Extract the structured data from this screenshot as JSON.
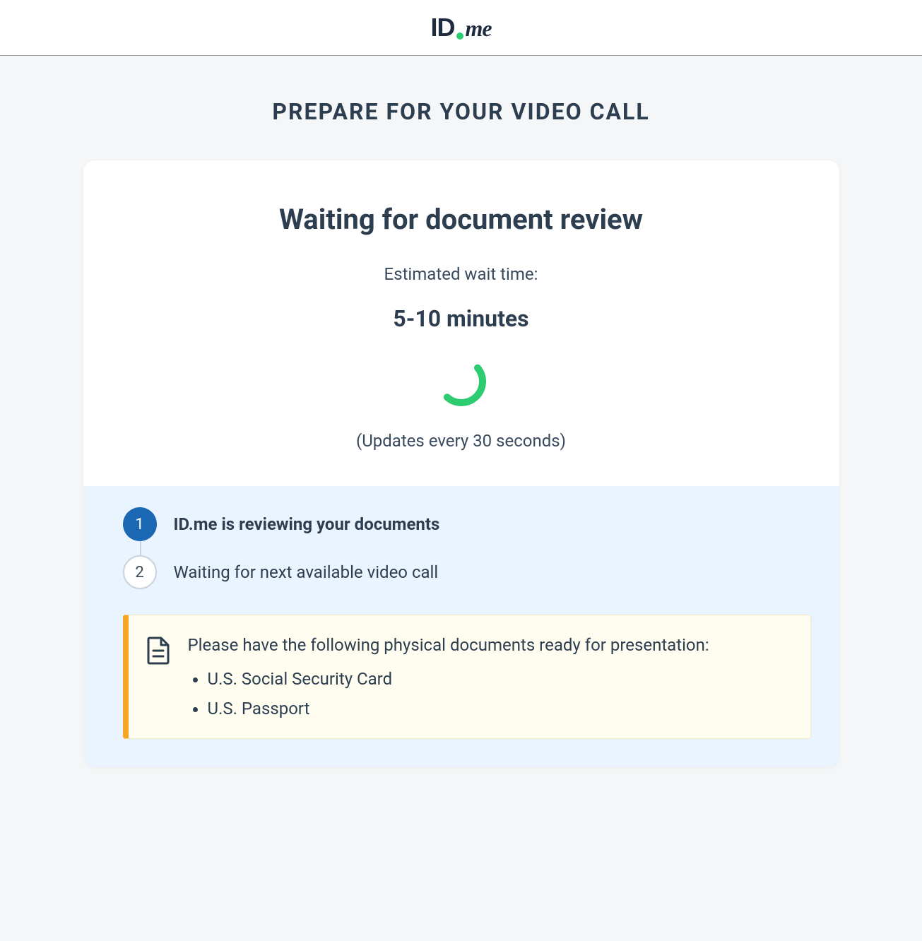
{
  "header": {
    "logo_id": "ID",
    "logo_me": "me"
  },
  "page_title": "PREPARE FOR YOUR VIDEO CALL",
  "card": {
    "heading": "Waiting for document review",
    "wait_label": "Estimated wait time:",
    "wait_time": "5-10 minutes",
    "update_note": "(Updates every 30 seconds)"
  },
  "steps": [
    {
      "number": "1",
      "label": "ID.me is reviewing your documents",
      "active": true
    },
    {
      "number": "2",
      "label": "Waiting for next available video call",
      "active": false
    }
  ],
  "notice": {
    "text": "Please have the following physical documents ready for presentation:",
    "items": [
      "U.S. Social Security Card",
      "U.S. Passport"
    ]
  }
}
